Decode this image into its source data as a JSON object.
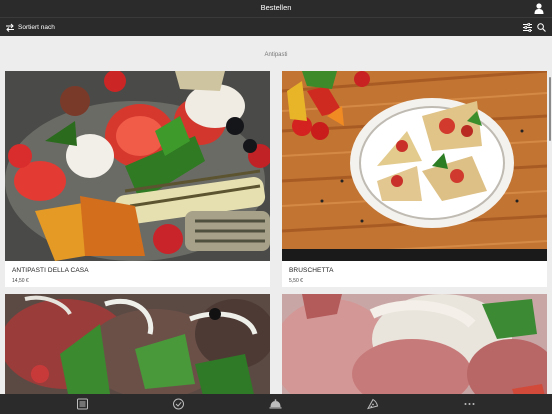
{
  "header": {
    "title": "Bestellen",
    "user_icon": "user-icon"
  },
  "toolbar": {
    "sort_label": "Sortiert nach",
    "sort_icon": "sort-arrows-icon",
    "filter_icon": "filter-sliders-icon",
    "search_icon": "search-icon"
  },
  "section": {
    "title": "Antipasti"
  },
  "items": [
    {
      "name": "ANTIPASTI DELLA CASA",
      "price": "14,50 €"
    },
    {
      "name": "BRUSCHETTA",
      "price": "5,50 €"
    },
    {
      "name": "",
      "price": ""
    },
    {
      "name": "",
      "price": ""
    }
  ],
  "bottom_nav": [
    {
      "icon": "menu-list-icon"
    },
    {
      "icon": "check-circle-icon"
    },
    {
      "icon": "cloche-icon"
    },
    {
      "icon": "pizza-slice-icon"
    },
    {
      "icon": "more-dots-icon"
    }
  ],
  "colors": {
    "bar": "#2b2b2b",
    "background": "#ededed",
    "card": "#ffffff"
  }
}
